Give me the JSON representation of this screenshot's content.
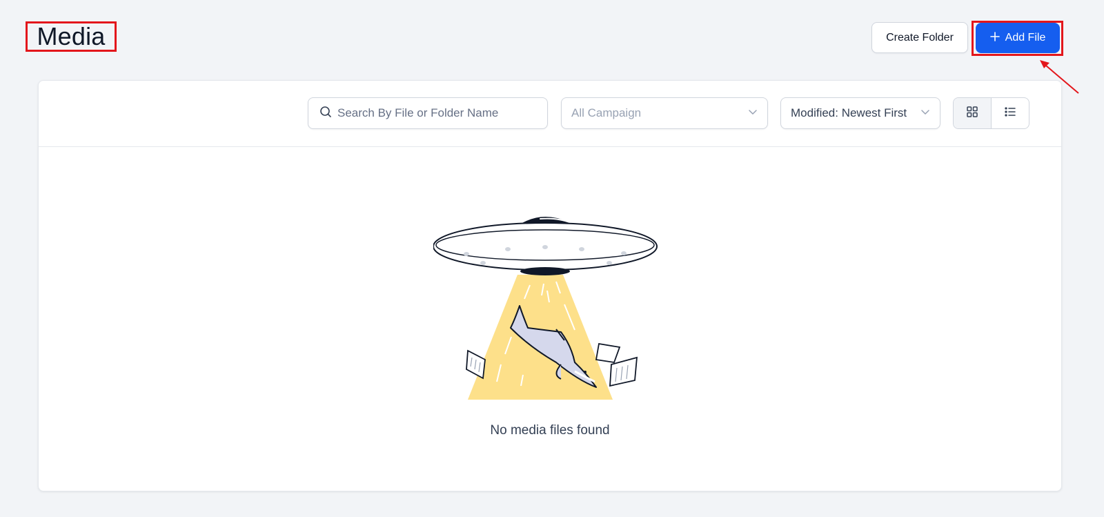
{
  "header": {
    "title": "Media",
    "create_folder_label": "Create Folder",
    "add_file_label": "Add File"
  },
  "toolbar": {
    "search_placeholder": "Search By File or Folder Name",
    "campaign_value": "All Campaign",
    "sort_value": "Modified: Newest First",
    "active_view": "grid"
  },
  "empty_state": {
    "message": "No media files found"
  },
  "colors": {
    "primary": "#155eef",
    "highlight": "#e3161b",
    "beam": "#fde08a"
  }
}
